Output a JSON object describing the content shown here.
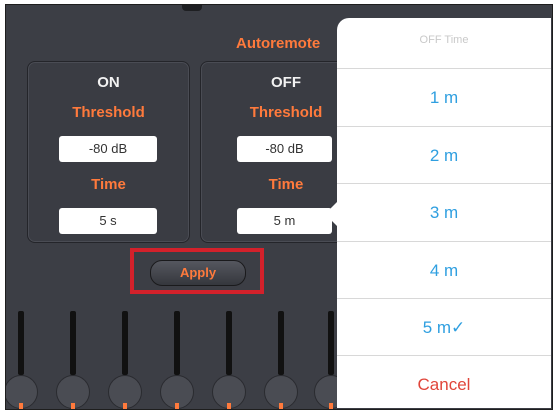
{
  "header": {
    "title": "Autoremote"
  },
  "on_panel": {
    "heading": "ON",
    "threshold_label": "Threshold",
    "threshold_value": "-80 dB",
    "time_label": "Time",
    "time_value": "5 s"
  },
  "off_panel": {
    "heading": "OFF",
    "threshold_label": "Threshold",
    "threshold_value": "-80 dB",
    "time_label": "Time",
    "time_value": "5 m"
  },
  "apply": {
    "label": "Apply"
  },
  "popover": {
    "title": "OFF Time",
    "options": [
      {
        "label": "1 m"
      },
      {
        "label": "2 m"
      },
      {
        "label": "3 m"
      },
      {
        "label": "4 m"
      },
      {
        "label": "5 m✓"
      }
    ],
    "cancel_label": "Cancel"
  },
  "colors": {
    "accent": "#ff7a3c",
    "option_text": "#2f9fe0",
    "cancel_text": "#e0453a",
    "highlight_border": "#d3212b"
  }
}
